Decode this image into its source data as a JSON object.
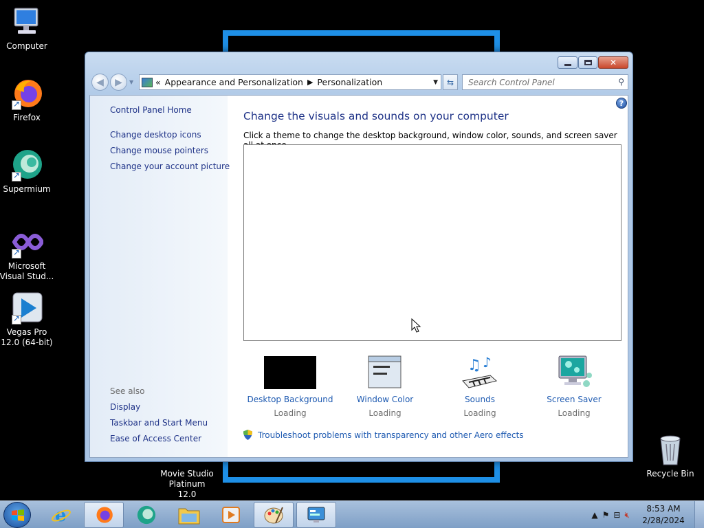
{
  "desktop": {
    "icons": [
      {
        "label": "Computer"
      },
      {
        "label": "Firefox"
      },
      {
        "label": "Supermium"
      },
      {
        "label": "Microsoft Visual Stud..."
      },
      {
        "label": "Vegas Pro 12.0 (64-bit)"
      },
      {
        "label": "Movie Studio Platinum 12.0"
      },
      {
        "label": "Recycle Bin"
      }
    ]
  },
  "window": {
    "nav": {
      "breadcrumb_prefix": "«",
      "breadcrumb": [
        "Appearance and Personalization",
        "Personalization"
      ],
      "search_placeholder": "Search Control Panel"
    },
    "left_pane": {
      "home_link": "Control Panel Home",
      "links": [
        "Change desktop icons",
        "Change mouse pointers",
        "Change your account picture"
      ],
      "see_also_heading": "See also",
      "see_also": [
        "Display",
        "Taskbar and Start Menu",
        "Ease of Access Center"
      ]
    },
    "main": {
      "title": "Change the visuals and sounds on your computer",
      "description": "Click a theme to change the desktop background, window color, sounds, and screen saver all at once.",
      "features": [
        {
          "label": "Desktop Background",
          "status": "Loading",
          "icon": "desktop-background-icon"
        },
        {
          "label": "Window Color",
          "status": "Loading",
          "icon": "window-color-icon"
        },
        {
          "label": "Sounds",
          "status": "Loading",
          "icon": "sounds-icon"
        },
        {
          "label": "Screen Saver",
          "status": "Loading",
          "icon": "screen-saver-icon"
        }
      ],
      "troubleshoot_link": "Troubleshoot problems with transparency and other Aero effects"
    }
  },
  "taskbar": {
    "pinned": [
      "internet-explorer",
      "firefox",
      "supermium",
      "file-explorer",
      "media-player",
      "paint",
      "control-panel"
    ],
    "clock": {
      "time": "8:53 AM",
      "date": "2/28/2024"
    }
  },
  "colors": {
    "link": "#1e5ab1",
    "heading": "#1e3287",
    "frame_accent": "#1e8fe6"
  }
}
